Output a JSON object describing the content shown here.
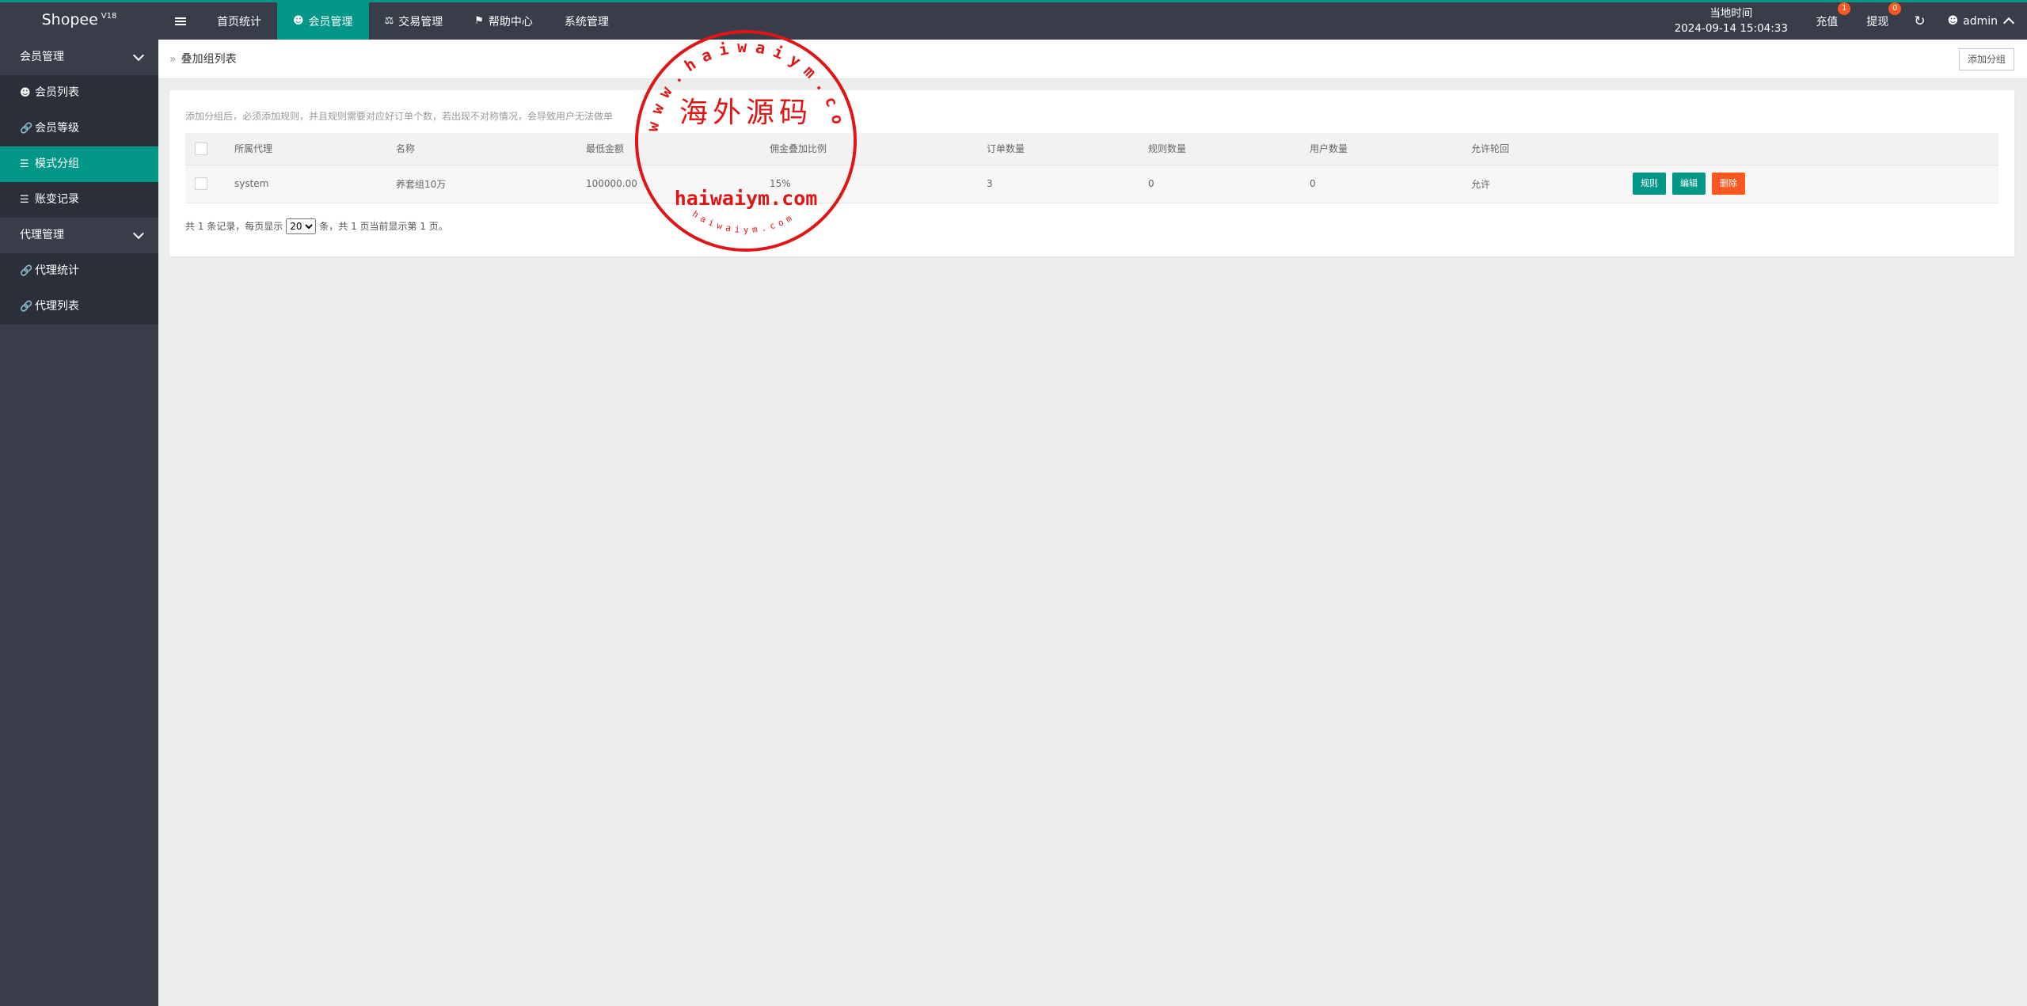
{
  "app": {
    "name": "Shopee",
    "version": "V18"
  },
  "topnav": [
    {
      "label": "首页统计",
      "icon": "",
      "active": false
    },
    {
      "label": "会员管理",
      "icon": "user-icon",
      "active": true
    },
    {
      "label": "交易管理",
      "icon": "scale-icon",
      "active": false
    },
    {
      "label": "帮助中心",
      "icon": "flag-icon",
      "active": false
    },
    {
      "label": "系统管理",
      "icon": "",
      "active": false
    }
  ],
  "header": {
    "clock_label": "当地时间",
    "clock_value": "2024-09-14 15:04:33",
    "recharge": {
      "label": "充值",
      "badge": "1"
    },
    "withdraw": {
      "label": "提现",
      "badge": "0"
    },
    "user": "admin"
  },
  "sidebar": {
    "groups": [
      {
        "label": "会员管理",
        "items": [
          {
            "label": "会员列表",
            "icon": "user-icon",
            "active": false
          },
          {
            "label": "会员等级",
            "icon": "link-icon",
            "active": false
          },
          {
            "label": "模式分组",
            "icon": "list-icon",
            "active": true
          },
          {
            "label": "账变记录",
            "icon": "list-icon",
            "active": false
          }
        ]
      },
      {
        "label": "代理管理",
        "items": [
          {
            "label": "代理统计",
            "icon": "link-icon",
            "active": false
          },
          {
            "label": "代理列表",
            "icon": "link-icon",
            "active": false
          }
        ]
      }
    ]
  },
  "breadcrumb": {
    "title": "叠加组列表"
  },
  "toolbar": {
    "add_group": "添加分组"
  },
  "notice": "添加分组后，必须添加规则，并且规则需要对应好订单个数，若出现不对称情况，会导致用户无法做单",
  "table": {
    "columns": [
      "所属代理",
      "名称",
      "最低金额",
      "佣金叠加比例",
      "订单数量",
      "规则数量",
      "用户数量",
      "允许轮回"
    ],
    "rows": [
      {
        "agent": "system",
        "name": "养套组10万",
        "min_amount": "100000.00",
        "ratio": "15%",
        "orders": "3",
        "rules": "0",
        "users": "0",
        "loop": "允许"
      }
    ],
    "actions": {
      "rules": "规则",
      "edit": "编辑",
      "delete": "删除"
    }
  },
  "pagination": {
    "prefix": "共 1 条记录，每页显示",
    "page_size": "20",
    "suffix": "条，共 1 页当前显示第 1 页。"
  },
  "watermark": {
    "main": "海外源码",
    "url": "haiwaiym.com",
    "ring_top": "www.haiwaiym.com",
    "ring_bottom": "haiwaiym.com"
  },
  "colors": {
    "accent": "#009688",
    "danger": "#ff5722",
    "topbar": "#393d49",
    "stamp": "#e01616"
  }
}
